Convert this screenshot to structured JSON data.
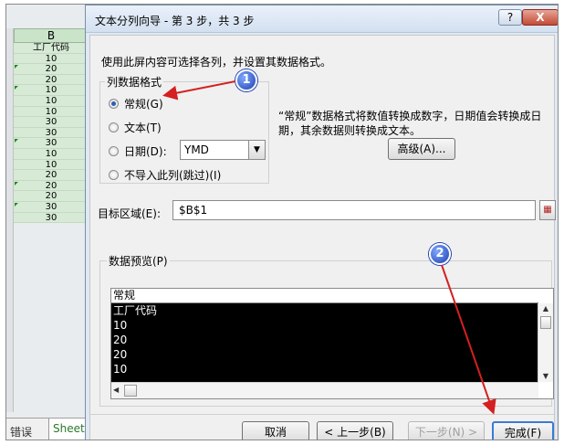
{
  "sheet": {
    "column_header": "B",
    "cells": [
      "工厂代码",
      "10",
      "20",
      "20",
      "10",
      "10",
      "10",
      "30",
      "30",
      "30",
      "10",
      "10",
      "20",
      "20",
      "20",
      "30",
      "30"
    ],
    "tabs": [
      "错误",
      "Sheet"
    ]
  },
  "dialog": {
    "title": "文本分列向导 - 第 3 步，共 3 步",
    "help_label": "?",
    "close_label": "X",
    "description": "使用此屏内容可选择各列，并设置其数据格式。",
    "format_group_title": "列数据格式",
    "format_options": [
      {
        "label": "常规(G)",
        "selected": true
      },
      {
        "label": "文本(T)",
        "selected": false
      },
      {
        "label": "日期(D):",
        "selected": false
      },
      {
        "label": "不导入此列(跳过)(I)",
        "selected": false
      }
    ],
    "date_format_value": "YMD",
    "info_text": "“常规”数据格式将数值转换成数字，日期值会转换成日期，其余数据则转换成文本。",
    "advanced_label": "高级(A)...",
    "destination_label": "目标区域(E):",
    "destination_value": "$B$1",
    "preview_title": "数据预览(P)",
    "preview_header": "常规",
    "preview_rows": [
      "工厂代码",
      "10",
      "20",
      "20",
      "10"
    ],
    "buttons": {
      "cancel": "取消",
      "prev": "< 上一步(B)",
      "next": "下一步(N) >",
      "finish": "完成(F)"
    }
  },
  "annotations": {
    "step1": "1",
    "step2": "2",
    "arrow_color": "#d42020"
  }
}
